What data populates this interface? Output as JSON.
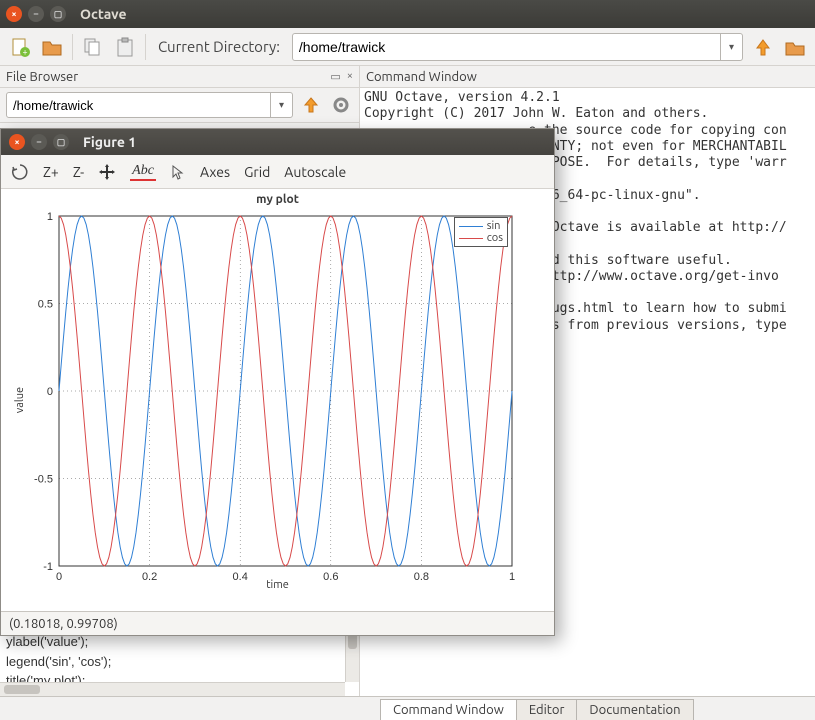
{
  "app": {
    "title": "Octave"
  },
  "toolbar": {
    "current_dir_label": "Current Directory:",
    "current_dir_value": "/home/trawick"
  },
  "file_browser": {
    "title": "File Browser",
    "path": "/home/trawick"
  },
  "history": {
    "lines": "(0.18018, 0.99708)\nxlabel('time');\nylabel('value');\nlegend('sin', 'cos');\ntitle('my plot');"
  },
  "command_window": {
    "title": "Command Window",
    "text": "GNU Octave, version 4.2.1\nCopyright (C) 2017 John W. Eaton and others.\n                     e the source code for copying con\n                     RRANTY; not even for MERCHANTABIL\n                     PURPOSE.  For details, type 'warr\n\n                     \"x86_64-pc-linux-gnu\".\n\n                     ut Octave is available at http://\n\n                     find this software useful.\n                     t http://www.octave.org/get-invo\n\n                     g/bugs.html to learn how to submi\n                     nges from previous versions, type\n\n\n                     t);\n                     t);"
  },
  "figure": {
    "title": "Figure 1",
    "toolbar": {
      "zin": "Z+",
      "zout": "Z-",
      "axes": "Axes",
      "grid": "Grid",
      "autoscale": "Autoscale"
    },
    "status": "(0.18018, 0.99708)"
  },
  "tabs": {
    "cmd": "Command Window",
    "editor": "Editor",
    "doc": "Documentation"
  },
  "chart_data": {
    "type": "line",
    "title": "my plot",
    "xlabel": "time",
    "ylabel": "value",
    "xlim": [
      0,
      1
    ],
    "ylim": [
      -1,
      1
    ],
    "xticks": [
      0,
      0.2,
      0.4,
      0.6,
      0.8,
      1
    ],
    "yticks": [
      -1,
      -0.5,
      0,
      0.5,
      1
    ],
    "legend": [
      "sin",
      "cos"
    ],
    "series": [
      {
        "name": "sin",
        "color": "#2f7fd4",
        "fn": "sin",
        "freq": 5,
        "amp": 1
      },
      {
        "name": "cos",
        "color": "#d84a4a",
        "fn": "cos",
        "freq": 5,
        "amp": 1
      }
    ],
    "grid": true
  }
}
